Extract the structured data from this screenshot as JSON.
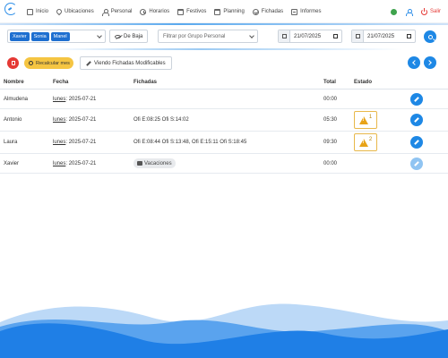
{
  "nav": {
    "items": [
      {
        "label": "Inicio",
        "icon": "grid-icon"
      },
      {
        "label": "Ubicaciones",
        "icon": "location-icon"
      },
      {
        "label": "Personal",
        "icon": "user-icon"
      },
      {
        "label": "Horarios",
        "icon": "clock-icon"
      },
      {
        "label": "Festivos",
        "icon": "calendar-icon"
      },
      {
        "label": "Planning",
        "icon": "calendar-icon"
      },
      {
        "label": "Fichadas",
        "icon": "check-circle-icon"
      },
      {
        "label": "Informes",
        "icon": "list-icon"
      }
    ],
    "logout_label": "Salir"
  },
  "filters": {
    "selected_people": [
      "Xavier",
      "Sonia",
      "Manel"
    ],
    "de_baja_label": "De Baja",
    "group_placeholder": "Filtrar por Grupo Personal",
    "date_from": "21/07/2025",
    "date_to": "21/07/2025"
  },
  "actions": {
    "recalc_label": "Recalcular mes",
    "view_label": "Viendo Fichadas Modificables"
  },
  "table": {
    "headers": {
      "name": "Nombre",
      "date": "Fecha",
      "fichadas": "Fichadas",
      "total": "Total",
      "estado": "Estado"
    },
    "rows": [
      {
        "name": "Almudena",
        "dow": "lunes",
        "date": "2025-07-21",
        "fichadas": "",
        "total": "00:00",
        "warn": "",
        "vacation": ""
      },
      {
        "name": "Antonio",
        "dow": "lunes",
        "date": "2025-07-21",
        "fichadas": "Ofi E:08:25 Ofi S:14:02",
        "total": "05:30",
        "warn": "1",
        "vacation": ""
      },
      {
        "name": "Laura",
        "dow": "lunes",
        "date": "2025-07-21",
        "fichadas": "Ofi E:08:44 Ofi S:13:48, Ofi E:15:11 Ofi S:18:45",
        "total": "09:30",
        "warn": "2",
        "vacation": ""
      },
      {
        "name": "Xavier",
        "dow": "lunes",
        "date": "2025-07-21",
        "fichadas": "",
        "total": "00:00",
        "warn": "",
        "vacation": "Vacaciones"
      }
    ]
  },
  "colors": {
    "primary": "#1e88e5",
    "danger": "#e53935",
    "warning": "#f5c542",
    "wave": "#1f7fe6"
  }
}
